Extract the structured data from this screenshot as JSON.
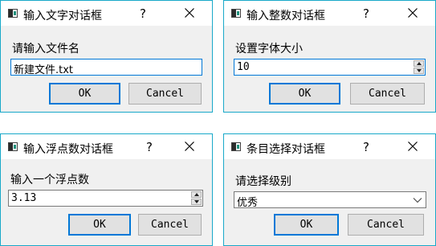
{
  "dialogs": [
    {
      "title": "输入文字对话框",
      "help_label": "?",
      "prompt": "请输入文件名",
      "input_value": "新建文件.txt",
      "ok_label": "OK",
      "cancel_label": "Cancel"
    },
    {
      "title": "输入整数对话框",
      "help_label": "?",
      "prompt": "设置字体大小",
      "input_value": "10",
      "ok_label": "OK",
      "cancel_label": "Cancel"
    },
    {
      "title": "输入浮点数对话框",
      "help_label": "?",
      "prompt": "输入一个浮点数",
      "input_value": "3.13",
      "ok_label": "OK",
      "cancel_label": "Cancel"
    },
    {
      "title": "条目选择对话框",
      "help_label": "?",
      "prompt": "请选择级别",
      "input_value": "优秀",
      "ok_label": "OK",
      "cancel_label": "Cancel"
    }
  ],
  "colors": {
    "window_border": "#19a9c9",
    "focus_accent": "#0078d7",
    "dialog_background": "#f0f0f0"
  },
  "icons": {
    "app_icon": "window-app-icon",
    "close_icon": "close-x-icon",
    "spin_up": "spin-up-arrow-icon",
    "spin_down": "spin-down-arrow-icon",
    "combo_arrow": "chevron-down-icon"
  }
}
